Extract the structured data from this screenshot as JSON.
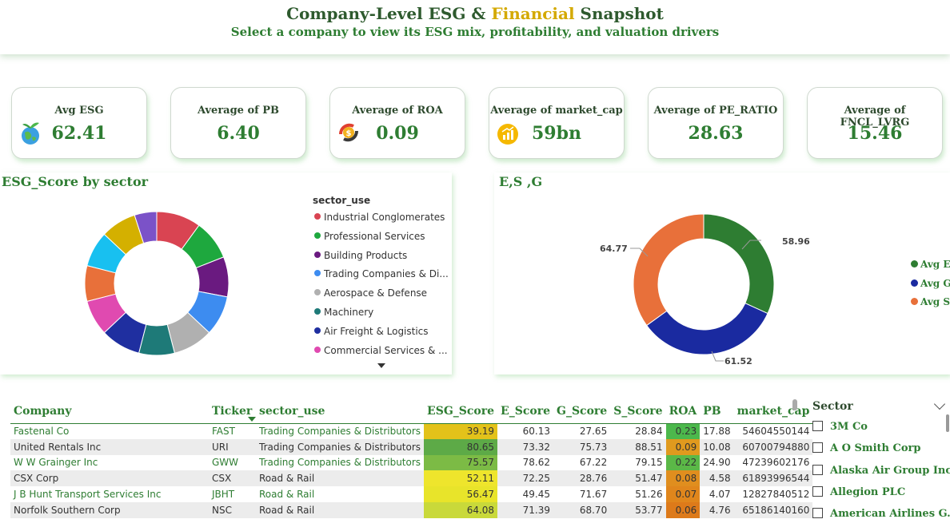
{
  "header": {
    "title_part1": "Company-Level ESG & ",
    "title_accent": "Financial",
    "title_part2": " Snapshot",
    "subtitle": "Select a company to view its ESG mix, profitability, and valuation drivers"
  },
  "kpis": [
    {
      "label": "Avg ESG",
      "value": "62.41",
      "icon": "globe-plant-icon"
    },
    {
      "label": "Average of PB",
      "value": "6.40"
    },
    {
      "label": "Average of ROA",
      "value": "0.09",
      "icon": "coin-cycle-icon"
    },
    {
      "label": "Average of market_cap",
      "value": "59bn",
      "icon": "growth-coin-icon"
    },
    {
      "label": "Average of PE_RATIO",
      "value": "28.63"
    },
    {
      "label": "Average of FNCL_LVRG",
      "value": "15.46"
    }
  ],
  "sector_chart": {
    "title": "ESG_Score by sector",
    "legend_title": "sector_use",
    "legend": [
      {
        "name": "Industrial Conglomerates",
        "color": "#d94452"
      },
      {
        "name": "Professional Services",
        "color": "#1ea83e"
      },
      {
        "name": "Building Products",
        "color": "#6a1a80"
      },
      {
        "name": "Trading Companies & Di...",
        "color": "#3d8cf0"
      },
      {
        "name": "Aerospace & Defense",
        "color": "#b0b0b0"
      },
      {
        "name": "Machinery",
        "color": "#1e7a78"
      },
      {
        "name": "Air Freight & Logistics",
        "color": "#1f2fa0"
      },
      {
        "name": "Commercial Services & ...",
        "color": "#e04ab0"
      }
    ]
  },
  "chart_data": [
    {
      "type": "pie",
      "title": "ESG_Score by sector",
      "legend_title": "sector_use",
      "slices": [
        {
          "color": "#d94452",
          "value": 10
        },
        {
          "color": "#1ea83e",
          "value": 9
        },
        {
          "color": "#6a1a80",
          "value": 9
        },
        {
          "color": "#3d8cf0",
          "value": 9
        },
        {
          "color": "#b0b0b0",
          "value": 9
        },
        {
          "color": "#1e7a78",
          "value": 8
        },
        {
          "color": "#1f2fa0",
          "value": 9
        },
        {
          "color": "#e04ab0",
          "value": 8
        },
        {
          "color": "#e8703a",
          "value": 8
        },
        {
          "color": "#18c0f0",
          "value": 8
        },
        {
          "color": "#d4b000",
          "value": 8
        },
        {
          "color": "#7b52c8",
          "value": 5
        }
      ]
    },
    {
      "type": "pie",
      "title": "E,S ,G",
      "slices": [
        {
          "name": "Avg E",
          "value": 58.96,
          "color": "#2e7d32"
        },
        {
          "name": "Avg G",
          "value": 61.52,
          "color": "#1a2aa0"
        },
        {
          "name": "Avg S",
          "value": 64.77,
          "color": "#e8703a"
        }
      ]
    }
  ],
  "esg_chart": {
    "title": "E,S ,G",
    "labels": [
      "58.96",
      "61.52",
      "64.77"
    ],
    "legend": [
      {
        "name": "Avg E",
        "color": "#2e7d32"
      },
      {
        "name": "Avg G",
        "color": "#1a2aa0"
      },
      {
        "name": "Avg S",
        "color": "#e8703a"
      }
    ]
  },
  "table": {
    "columns": [
      "Company",
      "Ticker",
      "sector_use",
      "ESG_Score",
      "E_Score",
      "G_Score",
      "S_Score",
      "ROA",
      "PB",
      "market_cap"
    ],
    "rows": [
      {
        "company": "Fastenal Co",
        "ticker": "FAST",
        "sector": "Trading Companies & Distributors",
        "esg": "39.19",
        "e": "60.13",
        "g": "27.65",
        "s": "28.84",
        "roa": "0.23",
        "pb": "17.88",
        "mcap": "54604550144",
        "esg_color": "#e3c21a",
        "roa_color": "#4cb84c"
      },
      {
        "company": "United Rentals Inc",
        "ticker": "URI",
        "sector": "Trading Companies & Distributors",
        "esg": "80.65",
        "e": "73.32",
        "g": "75.73",
        "s": "88.51",
        "roa": "0.09",
        "pb": "10.08",
        "mcap": "60700794880",
        "esg_color": "#5daa47",
        "roa_color": "#e09a1e"
      },
      {
        "company": "W W Grainger Inc",
        "ticker": "GWW",
        "sector": "Trading Companies & Distributors",
        "esg": "75.57",
        "e": "78.62",
        "g": "67.22",
        "s": "79.15",
        "roa": "0.22",
        "pb": "24.90",
        "mcap": "47239602176",
        "esg_color": "#7cbb45",
        "roa_color": "#5bb847"
      },
      {
        "company": "CSX Corp",
        "ticker": "CSX",
        "sector": "Road & Rail",
        "esg": "52.11",
        "e": "72.25",
        "g": "28.76",
        "s": "51.47",
        "roa": "0.08",
        "pb": "4.58",
        "mcap": "61893996544",
        "esg_color": "#eee52c",
        "roa_color": "#e08e1e"
      },
      {
        "company": "J B Hunt Transport Services Inc",
        "ticker": "JBHT",
        "sector": "Road & Rail",
        "esg": "56.47",
        "e": "49.45",
        "g": "71.67",
        "s": "51.26",
        "roa": "0.07",
        "pb": "4.07",
        "mcap": "12827840512",
        "esg_color": "#e8e42a",
        "roa_color": "#e0861c"
      },
      {
        "company": "Norfolk Southern Corp",
        "ticker": "NSC",
        "sector": "Road & Rail",
        "esg": "64.08",
        "e": "71.39",
        "g": "68.70",
        "s": "53.77",
        "roa": "0.06",
        "pb": "4.76",
        "mcap": "65186140160",
        "esg_color": "#c9d93a",
        "roa_color": "#dd7a1a"
      }
    ]
  },
  "slicer": {
    "title": "Sector",
    "items": [
      "3M Co",
      "A O Smith Corp",
      "Alaska Air Group Inc",
      "Allegion PLC",
      "American Airlines G..."
    ]
  }
}
